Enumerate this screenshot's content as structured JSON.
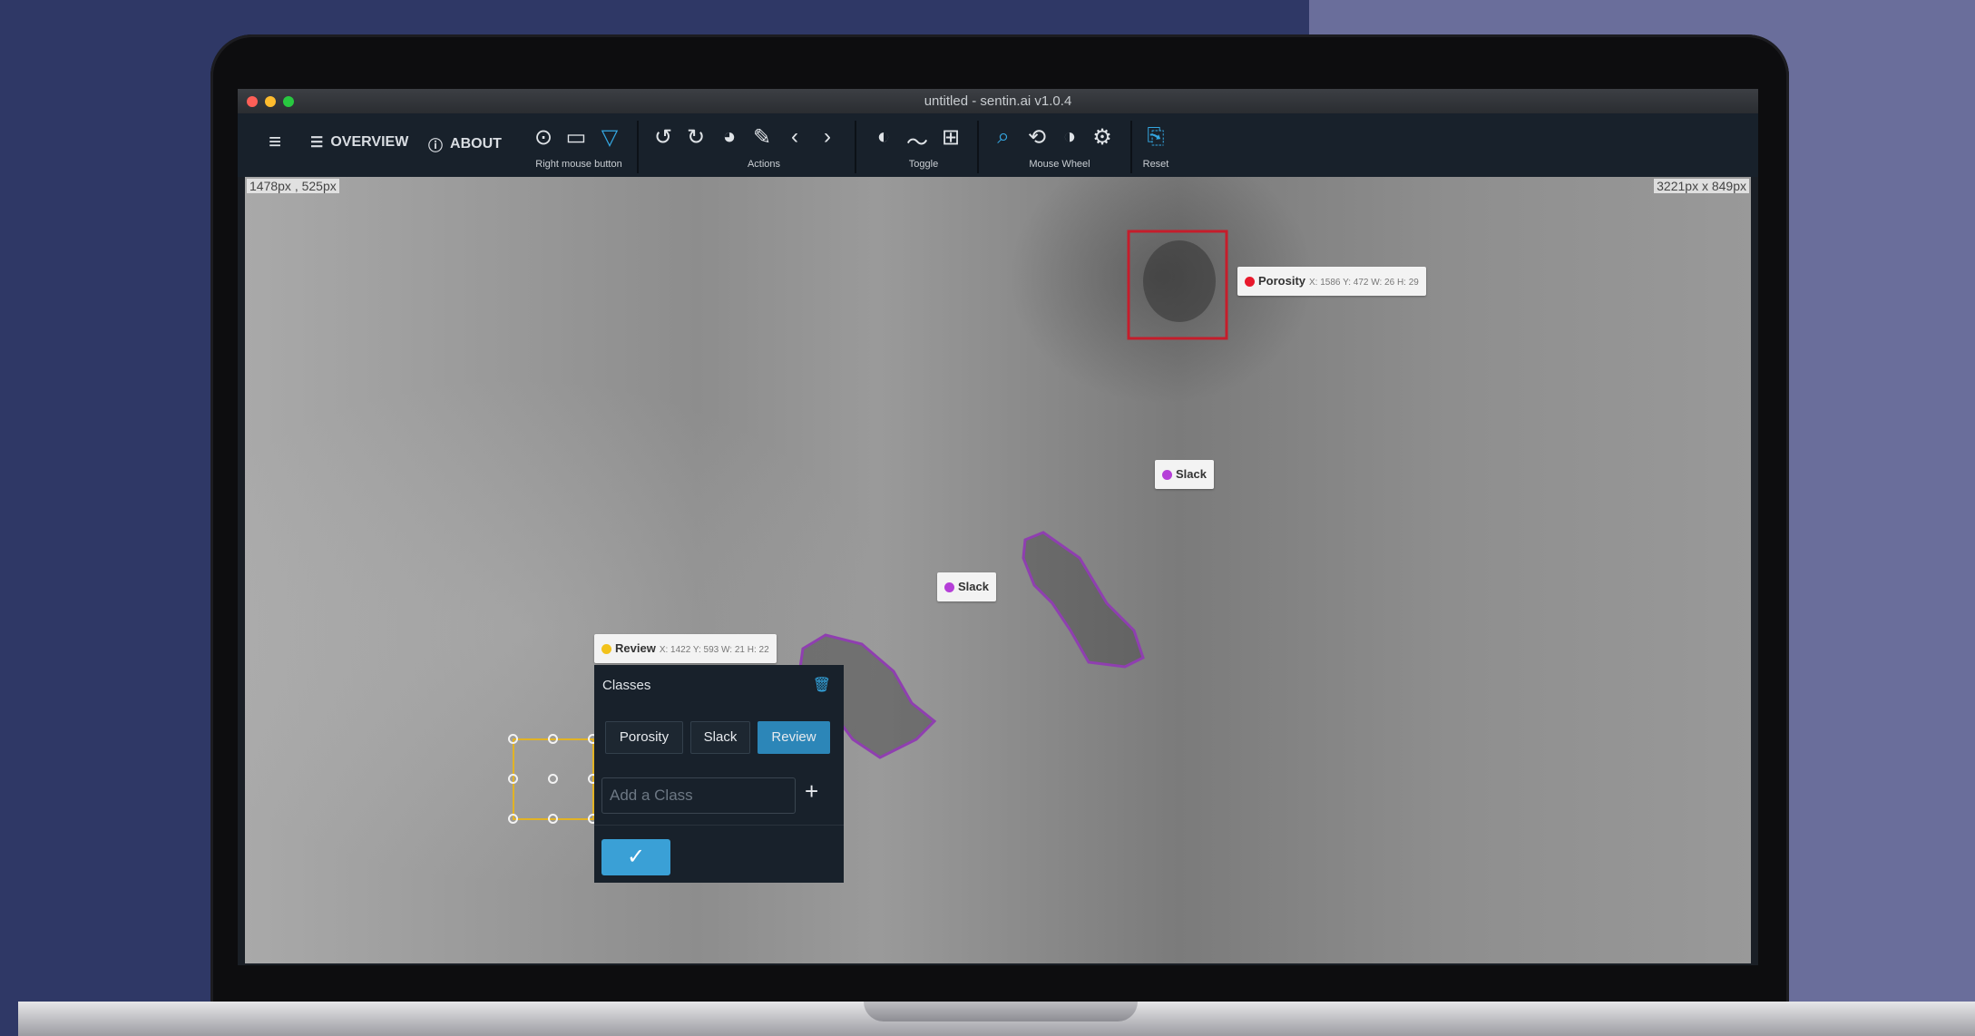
{
  "window": {
    "title": "untitled - sentin.ai v1.0.4"
  },
  "toolbar": {
    "overview_label": "OVERVIEW",
    "about_label": "ABOUT",
    "groups": {
      "right_mouse": "Right mouse button",
      "actions": "Actions",
      "toggle": "Toggle",
      "mouse_wheel": "Mouse Wheel",
      "reset": "Reset"
    },
    "icons": [
      "menu-icon",
      "overview-icon",
      "info-icon",
      "point-icon",
      "rectangle-icon",
      "polygon-icon",
      "rotate-left-icon",
      "rotate-right-icon",
      "palette-icon",
      "paperclip-icon",
      "prev-icon",
      "next-icon",
      "contrast-icon",
      "curve-icon",
      "grid-icon",
      "zoom-icon",
      "pan-icon",
      "brightness-icon",
      "gear-icon",
      "reset-icon"
    ]
  },
  "canvas": {
    "cursor_coord": "1478px , 525px",
    "image_size": "3221px x 849px"
  },
  "annotations": [
    {
      "class": "Porosity",
      "color": "#e8192c",
      "meta": "X: 1586 Y: 472 W: 26 H: 29"
    },
    {
      "class": "Slack",
      "color": "#b53fd8",
      "meta": ""
    },
    {
      "class": "Slack",
      "color": "#b53fd8",
      "meta": ""
    },
    {
      "class": "Review",
      "color": "#f2c21b",
      "meta": "X: 1422 Y: 593 W: 21 H: 22"
    }
  ],
  "popup": {
    "title": "Classes",
    "classes": [
      "Porosity",
      "Slack",
      "Review"
    ],
    "active_class": "Review",
    "add_placeholder": "Add a Class"
  },
  "colors": {
    "accent": "#34a6e0",
    "active_button": "#2c86b8",
    "toolbar_bg": "#18212b"
  }
}
